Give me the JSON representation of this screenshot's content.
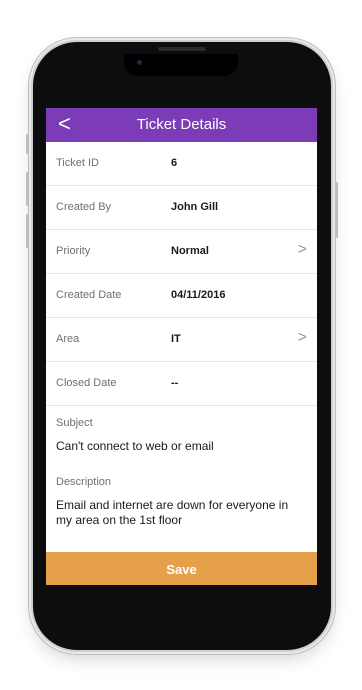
{
  "header": {
    "title": "Ticket Details",
    "back_icon": "<"
  },
  "fields": [
    {
      "label": "Ticket ID",
      "value": "6"
    },
    {
      "label": "Created By",
      "value": "John Gill"
    },
    {
      "label": "Priority",
      "value": "Normal"
    },
    {
      "label": "Created Date",
      "value": "04/11/2016"
    },
    {
      "label": "Area",
      "value": "IT"
    },
    {
      "label": "Closed Date",
      "value": "--"
    }
  ],
  "chevron": ">",
  "subject": {
    "label": "Subject",
    "value": "Can't connect to web or email"
  },
  "description": {
    "label": "Description",
    "value": "Email and internet are down for everyone in my area on the 1st floor"
  },
  "save_label": "Save",
  "colors": {
    "header": "#7c3cb8",
    "save": "#e6a04a"
  }
}
